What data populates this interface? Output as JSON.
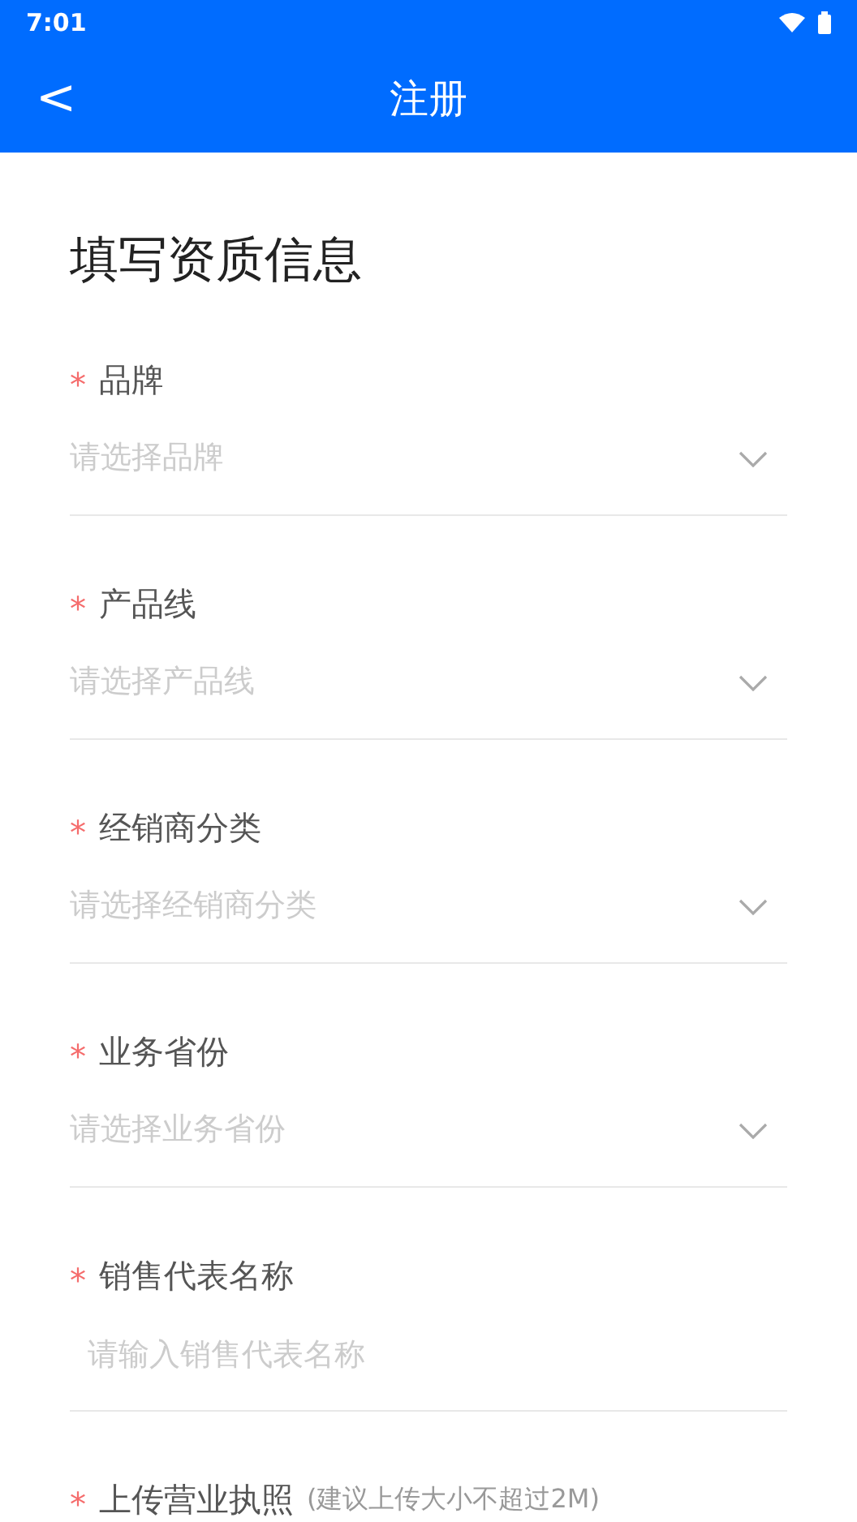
{
  "status_bar": {
    "time": "7:01"
  },
  "header": {
    "back": "<",
    "title": "注册"
  },
  "form": {
    "heading": "填写资质信息",
    "fields": [
      {
        "kind": "select",
        "mark": "*",
        "label": "品牌",
        "placeholder": "请选择品牌"
      },
      {
        "kind": "select",
        "mark": "*",
        "label": "产品线",
        "placeholder": "请选择产品线"
      },
      {
        "kind": "select",
        "mark": "*",
        "label": "经销商分类",
        "placeholder": "请选择经销商分类"
      },
      {
        "kind": "select",
        "mark": "*",
        "label": "业务省份",
        "placeholder": "请选择业务省份"
      },
      {
        "kind": "input",
        "mark": "*",
        "label": "销售代表名称",
        "placeholder": "请输入销售代表名称"
      },
      {
        "kind": "upload",
        "mark": "*",
        "label": "上传营业执照",
        "hint": "(建议上传大小不超过2M)"
      }
    ]
  }
}
